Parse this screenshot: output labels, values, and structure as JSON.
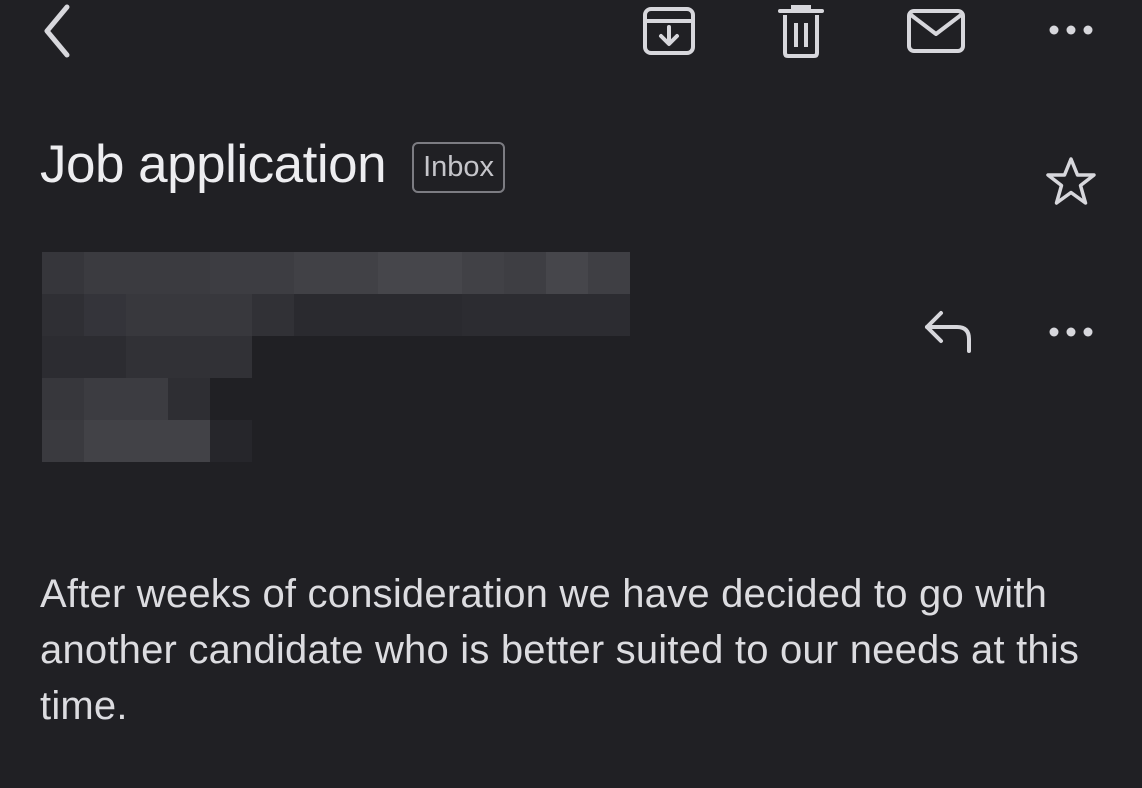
{
  "toolbar": {
    "icons": [
      "back-chevron-icon",
      "archive-icon",
      "trash-icon",
      "mail-icon",
      "more-horizontal-icon"
    ]
  },
  "message": {
    "subject": "Job application",
    "label": "Inbox",
    "body": "After weeks of consideration we have decided to go with another candidate who is better suited to our needs at this time."
  },
  "colors": {
    "background": "#202024",
    "text": "#ededf0",
    "chip_border": "#7c7c82",
    "icon": "#d7d7dc"
  }
}
